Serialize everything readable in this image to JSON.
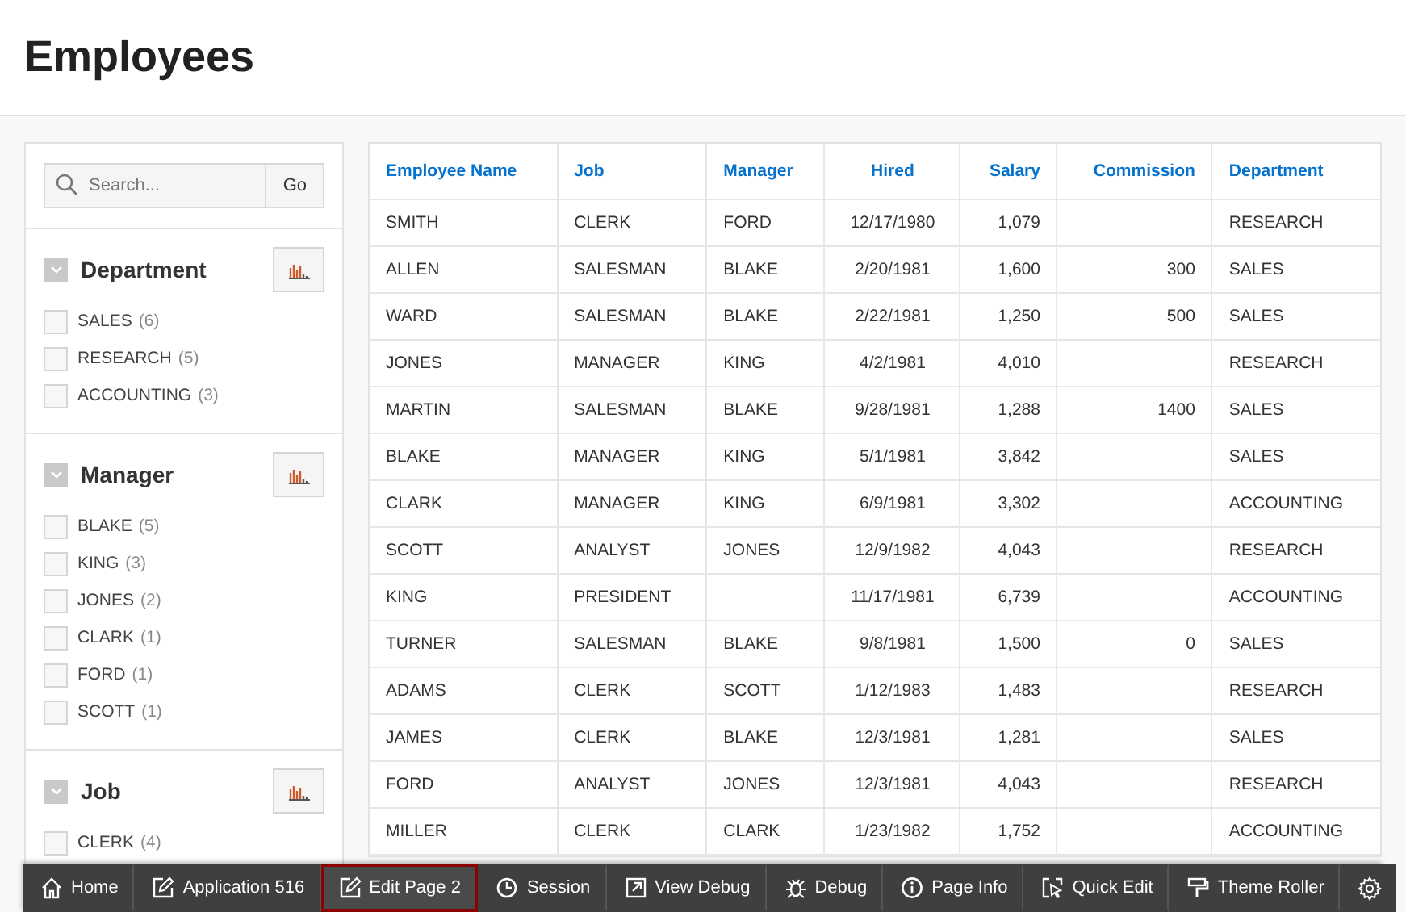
{
  "page_title": "Employees",
  "search": {
    "placeholder": "Search...",
    "button": "Go"
  },
  "facets": [
    {
      "title": "Department",
      "expanded": true,
      "options": [
        {
          "label": "SALES",
          "count": "(6)",
          "checked": false
        },
        {
          "label": "RESEARCH",
          "count": "(5)",
          "checked": false
        },
        {
          "label": "ACCOUNTING",
          "count": "(3)",
          "checked": false
        }
      ]
    },
    {
      "title": "Manager",
      "expanded": true,
      "options": [
        {
          "label": "BLAKE",
          "count": "(5)",
          "checked": false
        },
        {
          "label": "KING",
          "count": "(3)",
          "checked": false
        },
        {
          "label": "JONES",
          "count": "(2)",
          "checked": false
        },
        {
          "label": "CLARK",
          "count": "(1)",
          "checked": false
        },
        {
          "label": "FORD",
          "count": "(1)",
          "checked": false
        },
        {
          "label": "SCOTT",
          "count": "(1)",
          "checked": false
        }
      ]
    },
    {
      "title": "Job",
      "expanded": true,
      "options": [
        {
          "label": "CLERK",
          "count": "(4)",
          "checked": false
        }
      ]
    }
  ],
  "table": {
    "columns": [
      "Employee Name",
      "Job",
      "Manager",
      "Hired",
      "Salary",
      "Commission",
      "Department"
    ],
    "rows": [
      [
        "SMITH",
        "CLERK",
        "FORD",
        "12/17/1980",
        "1,079",
        "",
        "RESEARCH"
      ],
      [
        "ALLEN",
        "SALESMAN",
        "BLAKE",
        "2/20/1981",
        "1,600",
        "300",
        "SALES"
      ],
      [
        "WARD",
        "SALESMAN",
        "BLAKE",
        "2/22/1981",
        "1,250",
        "500",
        "SALES"
      ],
      [
        "JONES",
        "MANAGER",
        "KING",
        "4/2/1981",
        "4,010",
        "",
        "RESEARCH"
      ],
      [
        "MARTIN",
        "SALESMAN",
        "BLAKE",
        "9/28/1981",
        "1,288",
        "1400",
        "SALES"
      ],
      [
        "BLAKE",
        "MANAGER",
        "KING",
        "5/1/1981",
        "3,842",
        "",
        "SALES"
      ],
      [
        "CLARK",
        "MANAGER",
        "KING",
        "6/9/1981",
        "3,302",
        "",
        "ACCOUNTING"
      ],
      [
        "SCOTT",
        "ANALYST",
        "JONES",
        "12/9/1982",
        "4,043",
        "",
        "RESEARCH"
      ],
      [
        "KING",
        "PRESIDENT",
        "",
        "11/17/1981",
        "6,739",
        "",
        "ACCOUNTING"
      ],
      [
        "TURNER",
        "SALESMAN",
        "BLAKE",
        "9/8/1981",
        "1,500",
        "0",
        "SALES"
      ],
      [
        "ADAMS",
        "CLERK",
        "SCOTT",
        "1/12/1983",
        "1,483",
        "",
        "RESEARCH"
      ],
      [
        "JAMES",
        "CLERK",
        "BLAKE",
        "12/3/1981",
        "1,281",
        "",
        "SALES"
      ],
      [
        "FORD",
        "ANALYST",
        "JONES",
        "12/3/1981",
        "4,043",
        "",
        "RESEARCH"
      ],
      [
        "MILLER",
        "CLERK",
        "CLARK",
        "1/23/1982",
        "1,752",
        "",
        "ACCOUNTING"
      ]
    ]
  },
  "developer_toolbar": [
    {
      "label": "Home",
      "selected": false
    },
    {
      "label": "Application 516",
      "selected": false
    },
    {
      "label": "Edit Page 2",
      "selected": true
    },
    {
      "label": "Session",
      "selected": false
    },
    {
      "label": "View Debug",
      "selected": false
    },
    {
      "label": "Debug",
      "selected": false
    },
    {
      "label": "Page Info",
      "selected": false
    },
    {
      "label": "Quick Edit",
      "selected": false
    },
    {
      "label": "Theme Roller",
      "selected": false
    },
    {
      "selected": false
    }
  ]
}
